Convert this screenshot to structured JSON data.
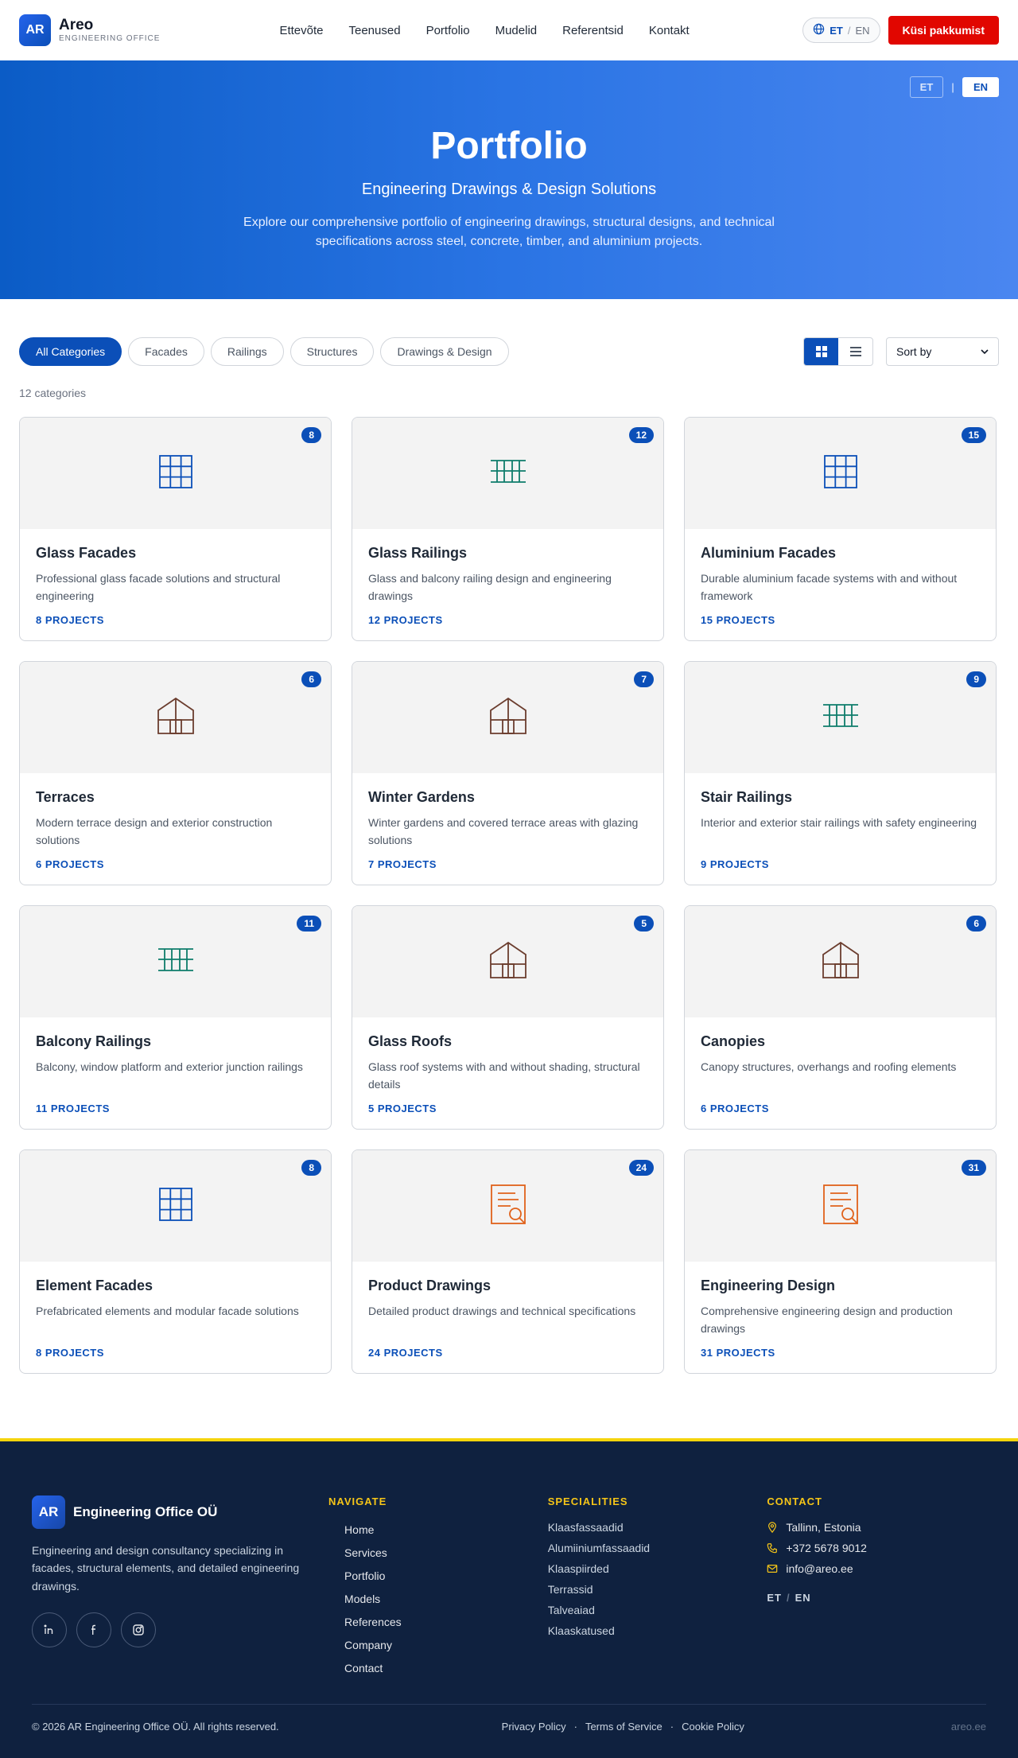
{
  "header": {
    "logo_badge": "AR",
    "logo_name": "Areo",
    "logo_sub": "ENGINEERING OFFICE",
    "nav": [
      "Ettevõte",
      "Teenused",
      "Portfolio",
      "Mudelid",
      "Referentsid",
      "Kontakt"
    ],
    "lang_active": "ET",
    "lang_sep": "/",
    "lang_inactive": "EN",
    "quote_button": "Küsi pakkumist"
  },
  "hero": {
    "lang_et": "ET",
    "lang_sep": "|",
    "lang_en": "EN",
    "title": "Portfolio",
    "subtitle": "Engineering Drawings & Design Solutions",
    "description": "Explore our comprehensive portfolio of engineering drawings, structural designs, and technical specifications across steel, concrete, timber, and aluminium projects."
  },
  "filters": {
    "chips": [
      "All Categories",
      "Facades",
      "Railings",
      "Structures",
      "Drawings & Design"
    ],
    "active_chip": 0,
    "sort_label": "Sort by",
    "count_text": "12 categories"
  },
  "cards": [
    {
      "title": "Glass Facades",
      "desc": "Professional glass facade solutions and structural engineering",
      "badge": "8",
      "link": "8 PROJECTS",
      "icon": "facade-grid-icon"
    },
    {
      "title": "Glass Railings",
      "desc": "Glass and balcony railing design and engineering drawings",
      "badge": "12",
      "link": "12 PROJECTS",
      "icon": "railing-icon"
    },
    {
      "title": "Aluminium Facades",
      "desc": "Durable aluminium facade systems with and without framework",
      "badge": "15",
      "link": "15 PROJECTS",
      "icon": "facade-grid-icon"
    },
    {
      "title": "Terraces",
      "desc": "Modern terrace design and exterior construction solutions",
      "badge": "6",
      "link": "6 PROJECTS",
      "icon": "house-icon"
    },
    {
      "title": "Winter Gardens",
      "desc": "Winter gardens and covered terrace areas with glazing solutions",
      "badge": "7",
      "link": "7 PROJECTS",
      "icon": "house-icon"
    },
    {
      "title": "Stair Railings",
      "desc": "Interior and exterior stair railings with safety engineering",
      "badge": "9",
      "link": "9 PROJECTS",
      "icon": "railing-icon"
    },
    {
      "title": "Balcony Railings",
      "desc": "Balcony, window platform and exterior junction railings",
      "badge": "11",
      "link": "11 PROJECTS",
      "icon": "railing-icon"
    },
    {
      "title": "Glass Roofs",
      "desc": "Glass roof systems with and without shading, structural details",
      "badge": "5",
      "link": "5 PROJECTS",
      "icon": "house-icon"
    },
    {
      "title": "Canopies",
      "desc": "Canopy structures, overhangs and roofing elements",
      "badge": "6",
      "link": "6 PROJECTS",
      "icon": "house-icon"
    },
    {
      "title": "Element Facades",
      "desc": "Prefabricated elements and modular facade solutions",
      "badge": "8",
      "link": "8 PROJECTS",
      "icon": "facade-grid-icon"
    },
    {
      "title": "Product Drawings",
      "desc": "Detailed product drawings and technical specifications",
      "badge": "24",
      "link": "24 PROJECTS",
      "icon": "document-search-icon"
    },
    {
      "title": "Engineering Design",
      "desc": "Comprehensive engineering design and production drawings",
      "badge": "31",
      "link": "31 PROJECTS",
      "icon": "document-search-icon"
    }
  ],
  "footer": {
    "badge": "AR",
    "brand": "Engineering Office OÜ",
    "brand_desc": "Engineering and design consultancy specializing in facades, structural elements, and detailed engineering drawings.",
    "navigate_head": "NAVIGATE",
    "navigate": [
      "Home",
      "Services",
      "Portfolio",
      "Models",
      "References",
      "Company",
      "Contact"
    ],
    "spec_head": "SPECIALITIES",
    "specialities": [
      "Klaasfassaadid",
      "Alumiiniumfassaadid",
      "Klaaspiirded",
      "Terrassid",
      "Talveaiad",
      "Klaaskatused"
    ],
    "contact_head": "CONTACT",
    "contact_location": "Tallinn, Estonia",
    "contact_phone": "+372 5678 9012",
    "contact_email": "info@areo.ee",
    "lang_et": "ET",
    "lang_sep": "/",
    "lang_en": "EN",
    "copyright": "© 2026 AR Engineering Office OÜ. All rights reserved.",
    "links": [
      "Privacy Policy",
      "Terms of Service",
      "Cookie Policy"
    ],
    "site": "areo.ee"
  },
  "colors": {
    "brand_blue": "#0b4fb8",
    "cta_red": "#e10600",
    "footer_bg": "#0f213f",
    "footer_accent": "#f5c518",
    "icon_blue": "#0b4fb8",
    "icon_teal": "#0e7c6b",
    "icon_brown": "#6b3d2e",
    "icon_orange": "#e0621b"
  }
}
